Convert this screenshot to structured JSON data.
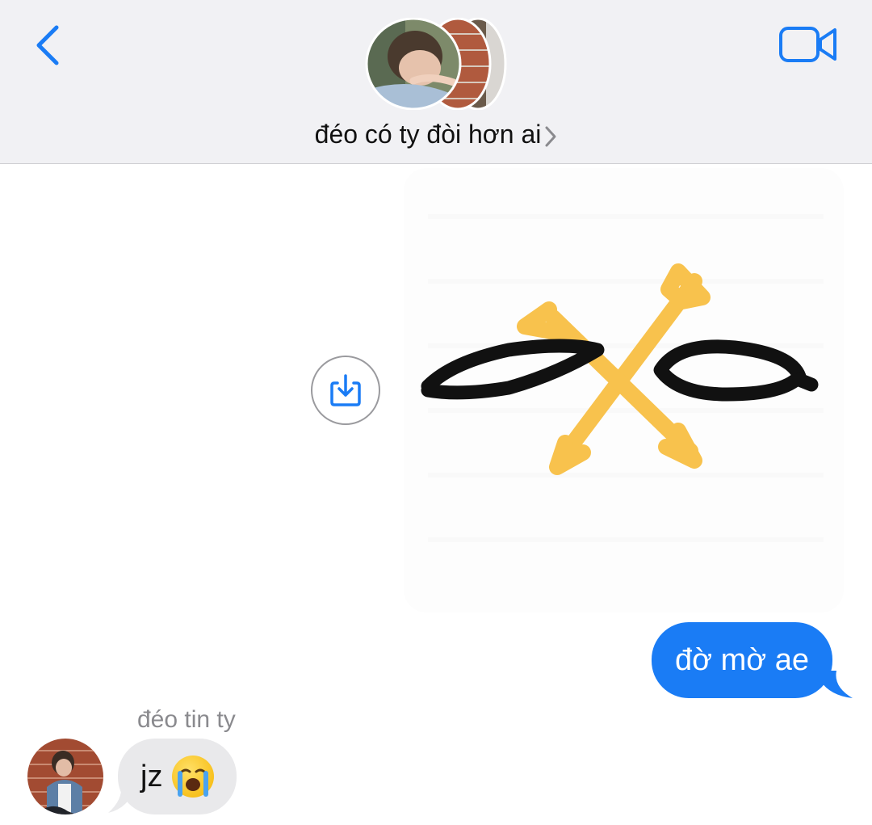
{
  "header": {
    "title": "đéo có ty đòi hơn ai",
    "back_icon": "chevron-left-icon",
    "video_icon": "video-camera-icon",
    "accent_color": "#1a7cf5"
  },
  "messages": {
    "outgoing_text": "đờ mờ ae",
    "incoming_sender": "đéo tin ty",
    "incoming_text": "jz",
    "incoming_emoji": "loudly-crying-face",
    "outgoing_color": "#1a7cf5",
    "incoming_color": "#e9e9eb"
  },
  "sticker": {
    "save_icon": "save-tray-icon"
  }
}
